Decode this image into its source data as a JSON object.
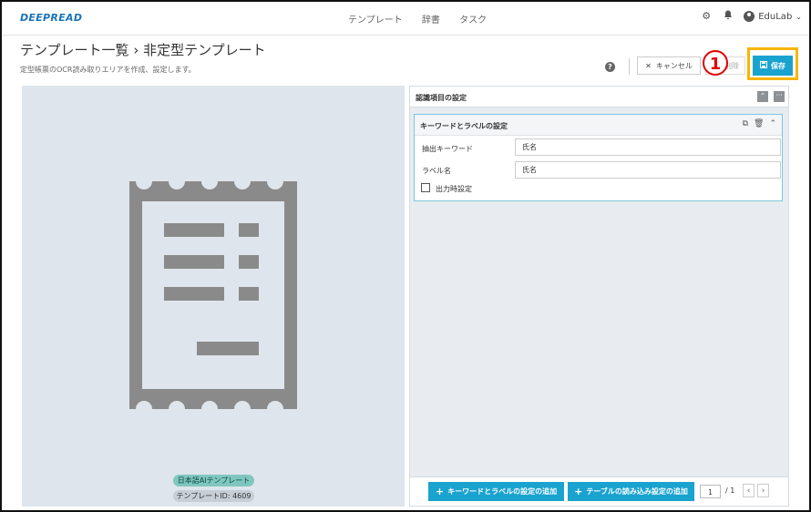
{
  "nav": {
    "logo": "DEEPREAD",
    "links": [
      "テンプレート",
      "辞書",
      "タスク"
    ],
    "user": "EduLab"
  },
  "header": {
    "title": "テンプレート一覧 › 非定型テンプレート",
    "description": "定型帳票のOCR読み取りエリアを作成、設定します。",
    "cancel_label": "キャンセル",
    "delete_label": "削除",
    "save_label": "保存",
    "marker": "1"
  },
  "preview": {
    "tag_ai": "日本語AIテンプレート",
    "tag_id": "テンプレートID: 4609"
  },
  "settings": {
    "panel_title": "認識項目の設定",
    "card_title": "キーワードとラベルの設定",
    "keyword_label": "抽出キーワード",
    "keyword_value": "氏名",
    "label_label": "ラベル名",
    "label_value": "氏名",
    "output_label": "出力時設定"
  },
  "footer": {
    "add_keyword_label": "キーワードとラベルの設定の追加",
    "add_table_label": "テーブルの読み込み設定の追加",
    "page_current": "1",
    "page_total": "/ 1"
  },
  "colors": {
    "accent": "#1aa3cf",
    "highlight": "#f7b500",
    "marker": "#e10000"
  }
}
